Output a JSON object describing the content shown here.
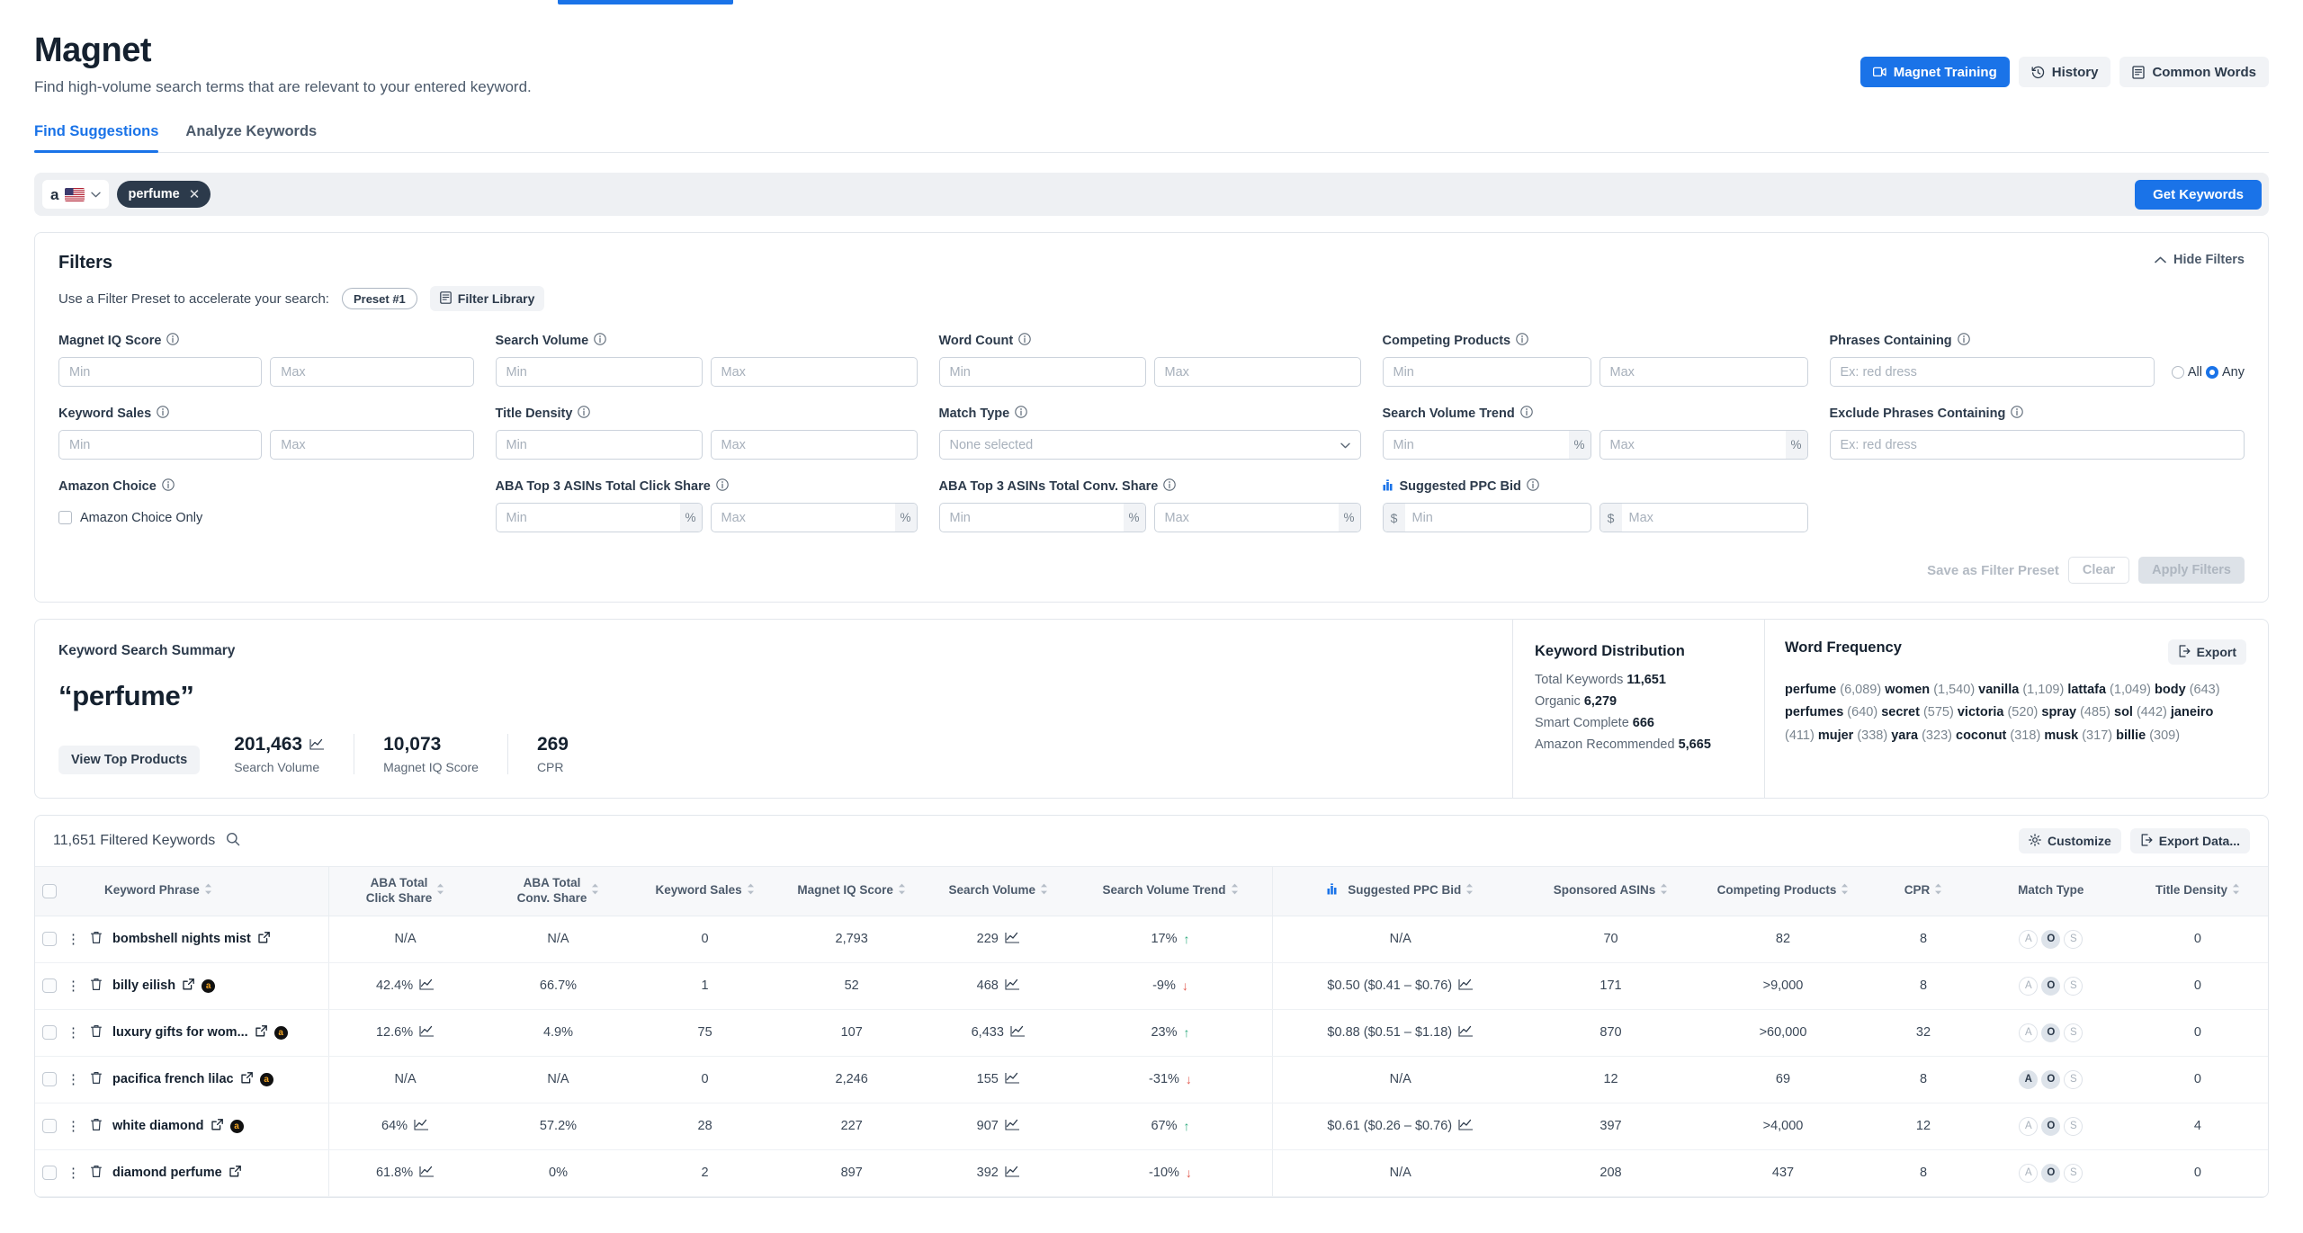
{
  "header": {
    "title": "Magnet",
    "subtitle": "Find high-volume search terms that are relevant to your entered keyword.",
    "actions": [
      {
        "label": "Magnet Training",
        "icon": "video-icon"
      },
      {
        "label": "History",
        "icon": "history-icon"
      },
      {
        "label": "Common Words",
        "icon": "book-icon"
      }
    ]
  },
  "tabs": [
    {
      "label": "Find Suggestions",
      "active": true
    },
    {
      "label": "Analyze Keywords",
      "active": false
    }
  ],
  "search": {
    "marketplace": "Amazon US",
    "amazon_letter": "a",
    "keyword_chip": "perfume",
    "get_keywords_label": "Get Keywords"
  },
  "filters": {
    "title": "Filters",
    "hide_label": "Hide Filters",
    "preset_text": "Use a Filter Preset to accelerate your search:",
    "preset_name": "Preset #1",
    "filter_library_label": "Filter Library",
    "fields": {
      "magnet_iq_score": {
        "label": "Magnet IQ Score",
        "min": "Min",
        "max": "Max"
      },
      "search_volume": {
        "label": "Search Volume",
        "min": "Min",
        "max": "Max"
      },
      "word_count": {
        "label": "Word Count",
        "min": "Min",
        "max": "Max"
      },
      "competing_products": {
        "label": "Competing Products",
        "min": "Min",
        "max": "Max"
      },
      "phrases_containing": {
        "label": "Phrases Containing",
        "placeholder": "Ex: red dress",
        "all_label": "All",
        "any_label": "Any",
        "selected": "Any"
      },
      "keyword_sales": {
        "label": "Keyword Sales",
        "min": "Min",
        "max": "Max"
      },
      "title_density": {
        "label": "Title Density",
        "min": "Min",
        "max": "Max"
      },
      "match_type": {
        "label": "Match Type",
        "value": "None selected"
      },
      "search_volume_trend": {
        "label": "Search Volume Trend",
        "min": "Min",
        "max": "Max",
        "unit": "%"
      },
      "exclude_phrases": {
        "label": "Exclude Phrases Containing",
        "placeholder": "Ex: red dress"
      },
      "amazon_choice": {
        "label": "Amazon Choice",
        "checkbox_label": "Amazon Choice Only"
      },
      "aba_click_share": {
        "label": "ABA Top 3 ASINs Total Click Share",
        "min": "Min",
        "max": "Max",
        "unit": "%"
      },
      "aba_conv_share": {
        "label": "ABA Top 3 ASINs Total Conv. Share",
        "min": "Min",
        "max": "Max",
        "unit": "%"
      },
      "suggested_ppc_bid": {
        "label": "Suggested PPC Bid",
        "min": "Min",
        "max": "Max",
        "unit": "$"
      }
    },
    "footer": {
      "save_preset": "Save as Filter Preset",
      "clear": "Clear",
      "apply": "Apply Filters"
    }
  },
  "summary": {
    "title": "Keyword Search Summary",
    "keyword": "“perfume”",
    "view_top_products": "View Top Products",
    "stats": [
      {
        "value": "201,463",
        "label": "Search Volume",
        "has_chart": true
      },
      {
        "value": "10,073",
        "label": "Magnet IQ Score",
        "has_chart": false
      },
      {
        "value": "269",
        "label": "CPR",
        "has_chart": false
      }
    ],
    "distribution": {
      "title": "Keyword Distribution",
      "rows": [
        {
          "label": "Total Keywords",
          "value": "11,651"
        },
        {
          "label": "Organic",
          "value": "6,279"
        },
        {
          "label": "Smart Complete",
          "value": "666"
        },
        {
          "label": "Amazon Recommended",
          "value": "5,665"
        }
      ]
    },
    "word_frequency": {
      "title": "Word Frequency",
      "export_label": "Export",
      "words": [
        {
          "word": "perfume",
          "count": "(6,089)"
        },
        {
          "word": "women",
          "count": "(1,540)"
        },
        {
          "word": "vanilla",
          "count": "(1,109)"
        },
        {
          "word": "lattafa",
          "count": "(1,049)"
        },
        {
          "word": "body",
          "count": "(643)"
        },
        {
          "word": "perfumes",
          "count": "(640)"
        },
        {
          "word": "secret",
          "count": "(575)"
        },
        {
          "word": "victoria",
          "count": "(520)"
        },
        {
          "word": "spray",
          "count": "(485)"
        },
        {
          "word": "sol",
          "count": "(442)"
        },
        {
          "word": "janeiro",
          "count": "(411)"
        },
        {
          "word": "mujer",
          "count": "(338)"
        },
        {
          "word": "yara",
          "count": "(323)"
        },
        {
          "word": "coconut",
          "count": "(318)"
        },
        {
          "word": "musk",
          "count": "(317)"
        },
        {
          "word": "billie",
          "count": "(309)"
        }
      ]
    }
  },
  "table": {
    "count_label": "11,651 Filtered Keywords",
    "customize_label": "Customize",
    "export_label": "Export Data...",
    "columns": [
      {
        "label": "Keyword Phrase",
        "sortable": true
      },
      {
        "label": "ABA Total Click Share",
        "sortable": true
      },
      {
        "label": "ABA Total Conv. Share",
        "sortable": true
      },
      {
        "label": "Keyword Sales",
        "sortable": true
      },
      {
        "label": "Magnet IQ Score",
        "sortable": true
      },
      {
        "label": "Search Volume",
        "sortable": true
      },
      {
        "label": "Search Volume Trend",
        "sortable": true
      },
      {
        "label": "Suggested PPC Bid",
        "sortable": true
      },
      {
        "label": "Sponsored ASINs",
        "sortable": true
      },
      {
        "label": "Competing Products",
        "sortable": true
      },
      {
        "label": "CPR",
        "sortable": true
      },
      {
        "label": "Match Type",
        "sortable": false
      },
      {
        "label": "Title Density",
        "sortable": true
      }
    ],
    "rows": [
      {
        "keyword": "bombshell nights mist",
        "amazon_choice": false,
        "aba_click_share": "N/A",
        "aba_click_chart": false,
        "aba_conv_share": "N/A",
        "keyword_sales": "0",
        "magnet_iq": "2,793",
        "search_volume": "229",
        "trend": "17%",
        "trend_dir": "up",
        "ppc_bid": "N/A",
        "ppc_chart": false,
        "sponsored_asins": "70",
        "competing_products": "82",
        "cpr": "8",
        "match_type": "O",
        "title_density": "0"
      },
      {
        "keyword": "billy eilish",
        "amazon_choice": true,
        "aba_click_share": "42.4%",
        "aba_click_chart": true,
        "aba_conv_share": "66.7%",
        "keyword_sales": "1",
        "magnet_iq": "52",
        "search_volume": "468",
        "trend": "-9%",
        "trend_dir": "down",
        "ppc_bid": "$0.50 ($0.41 – $0.76)",
        "ppc_chart": true,
        "sponsored_asins": "171",
        "competing_products": ">9,000",
        "cpr": "8",
        "match_type": "O",
        "title_density": "0"
      },
      {
        "keyword": "luxury gifts for wom...",
        "amazon_choice": true,
        "aba_click_share": "12.6%",
        "aba_click_chart": true,
        "aba_conv_share": "4.9%",
        "keyword_sales": "75",
        "magnet_iq": "107",
        "search_volume": "6,433",
        "trend": "23%",
        "trend_dir": "up",
        "ppc_bid": "$0.88 ($0.51 – $1.18)",
        "ppc_chart": true,
        "sponsored_asins": "870",
        "competing_products": ">60,000",
        "cpr": "32",
        "match_type": "O",
        "title_density": "0"
      },
      {
        "keyword": "pacifica french lilac",
        "amazon_choice": true,
        "aba_click_share": "N/A",
        "aba_click_chart": false,
        "aba_conv_share": "N/A",
        "keyword_sales": "0",
        "magnet_iq": "2,246",
        "search_volume": "155",
        "trend": "-31%",
        "trend_dir": "down",
        "ppc_bid": "N/A",
        "ppc_chart": false,
        "sponsored_asins": "12",
        "competing_products": "69",
        "cpr": "8",
        "match_type": "AO",
        "title_density": "0"
      },
      {
        "keyword": "white diamond",
        "amazon_choice": true,
        "aba_click_share": "64%",
        "aba_click_chart": true,
        "aba_conv_share": "57.2%",
        "keyword_sales": "28",
        "magnet_iq": "227",
        "search_volume": "907",
        "trend": "67%",
        "trend_dir": "up",
        "ppc_bid": "$0.61 ($0.26 – $0.76)",
        "ppc_chart": true,
        "sponsored_asins": "397",
        "competing_products": ">4,000",
        "cpr": "12",
        "match_type": "O",
        "title_density": "4"
      },
      {
        "keyword": "diamond perfume",
        "amazon_choice": false,
        "aba_click_share": "61.8%",
        "aba_click_chart": true,
        "aba_conv_share": "0%",
        "keyword_sales": "2",
        "magnet_iq": "897",
        "search_volume": "392",
        "trend": "-10%",
        "trend_dir": "down",
        "ppc_bid": "N/A",
        "ppc_chart": false,
        "sponsored_asins": "208",
        "competing_products": "437",
        "cpr": "8",
        "match_type": "O",
        "title_density": "0"
      }
    ],
    "match_type_letters": [
      "A",
      "O",
      "S"
    ]
  },
  "colors": {
    "accent": "#1a73e8",
    "chip_bg": "#2c3a4b",
    "up": "#2faa7e",
    "down": "#e2574c"
  }
}
